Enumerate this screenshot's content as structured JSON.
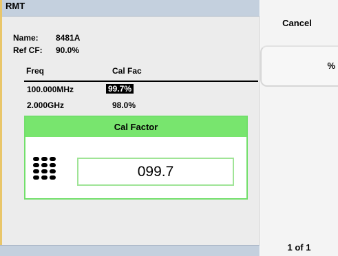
{
  "header": {
    "title": "RMT"
  },
  "sensor": {
    "name_label": "Name:",
    "name_value": "8481A",
    "refcf_label": "Ref CF:",
    "refcf_value": "90.0%"
  },
  "table": {
    "columns": [
      "Freq",
      "Cal Fac"
    ],
    "rows": [
      {
        "freq": "100.000MHz",
        "calfac": "99.7%",
        "selected": true
      },
      {
        "freq": "2.000GHz",
        "calfac": "98.0%",
        "selected": false
      }
    ]
  },
  "dialog": {
    "title": "Cal Factor",
    "value": "099.7",
    "icon": "keypad-icon"
  },
  "softkeys": {
    "cancel_label": "Cancel",
    "percent_label": "%",
    "page_indicator": "1 of 1"
  },
  "colors": {
    "dialog_header": "#78e56e",
    "title_bar": "#c4d0de",
    "panel_background": "#ececec"
  }
}
